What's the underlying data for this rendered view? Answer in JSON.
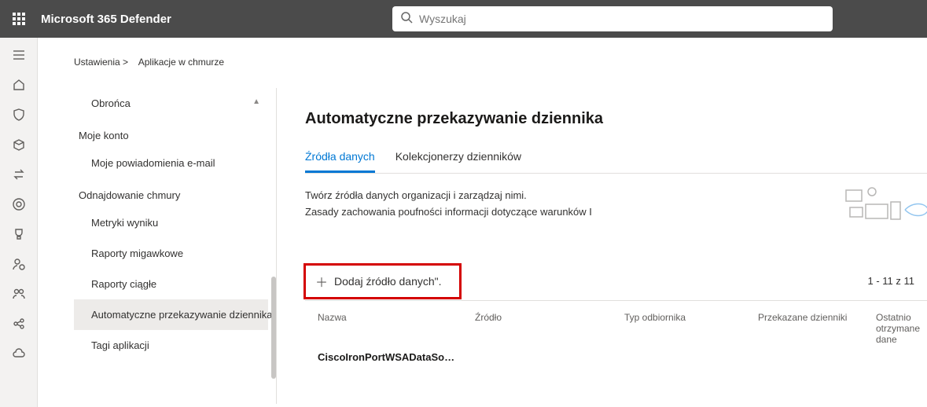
{
  "header": {
    "product_name": "Microsoft 365 Defender",
    "search_placeholder": "Wyszukaj"
  },
  "breadcrumb": {
    "root": "Ustawienia >",
    "leaf": "Aplikacje w chmurze"
  },
  "settings_nav": {
    "section0_item0": "Obrońca",
    "group1": "Moje konto",
    "group1_item0": "Moje powiadomienia e-mail",
    "group2": "Odnajdowanie chmury",
    "group2_item0": "Metryki wyniku",
    "group2_item1": "Raporty migawkowe",
    "group2_item2": "Raporty ciągłe",
    "group2_item3": "Automatyczne przekazywanie dziennika",
    "group2_item4": "Tagi aplikacji"
  },
  "main": {
    "title": "Automatyczne przekazywanie dziennika",
    "tab_sources": "Źródła danych",
    "tab_collectors": "Kolekcjonerzy dzienników",
    "description_line1": "Twórz źródła danych organizacji i zarządzaj nimi.",
    "description_line2": "Zasady zachowania poufności informacji dotyczące warunków I",
    "add_button": "Dodaj źródło danych\".",
    "counter": "1 - 11 z 11",
    "columns": {
      "name": "Nazwa",
      "source": "Źródło",
      "receiver_type": "Typ odbiornika",
      "forwarded_logs": "Przekazane dzienniki",
      "last_received": "Ostatnio otrzymane dane"
    },
    "row0": {
      "name": "CiscoIronPortWSADataSo…"
    }
  }
}
